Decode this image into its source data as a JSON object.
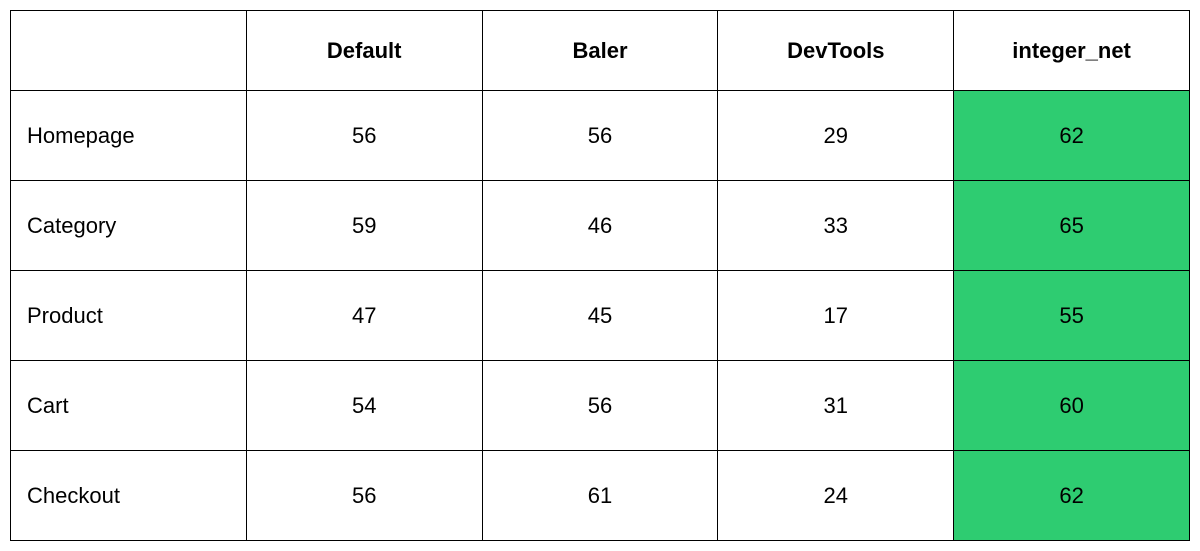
{
  "highlight_color": "#2ecc71",
  "chart_data": {
    "type": "table",
    "columns": [
      "Default",
      "Baler",
      "DevTools",
      "integer_net"
    ],
    "rows": [
      "Homepage",
      "Category",
      "Product",
      "Cart",
      "Checkout"
    ],
    "values": [
      [
        56,
        56,
        29,
        62
      ],
      [
        59,
        46,
        33,
        65
      ],
      [
        47,
        45,
        17,
        55
      ],
      [
        54,
        56,
        31,
        60
      ],
      [
        56,
        61,
        24,
        62
      ]
    ],
    "highlighted_column_index": 3
  }
}
